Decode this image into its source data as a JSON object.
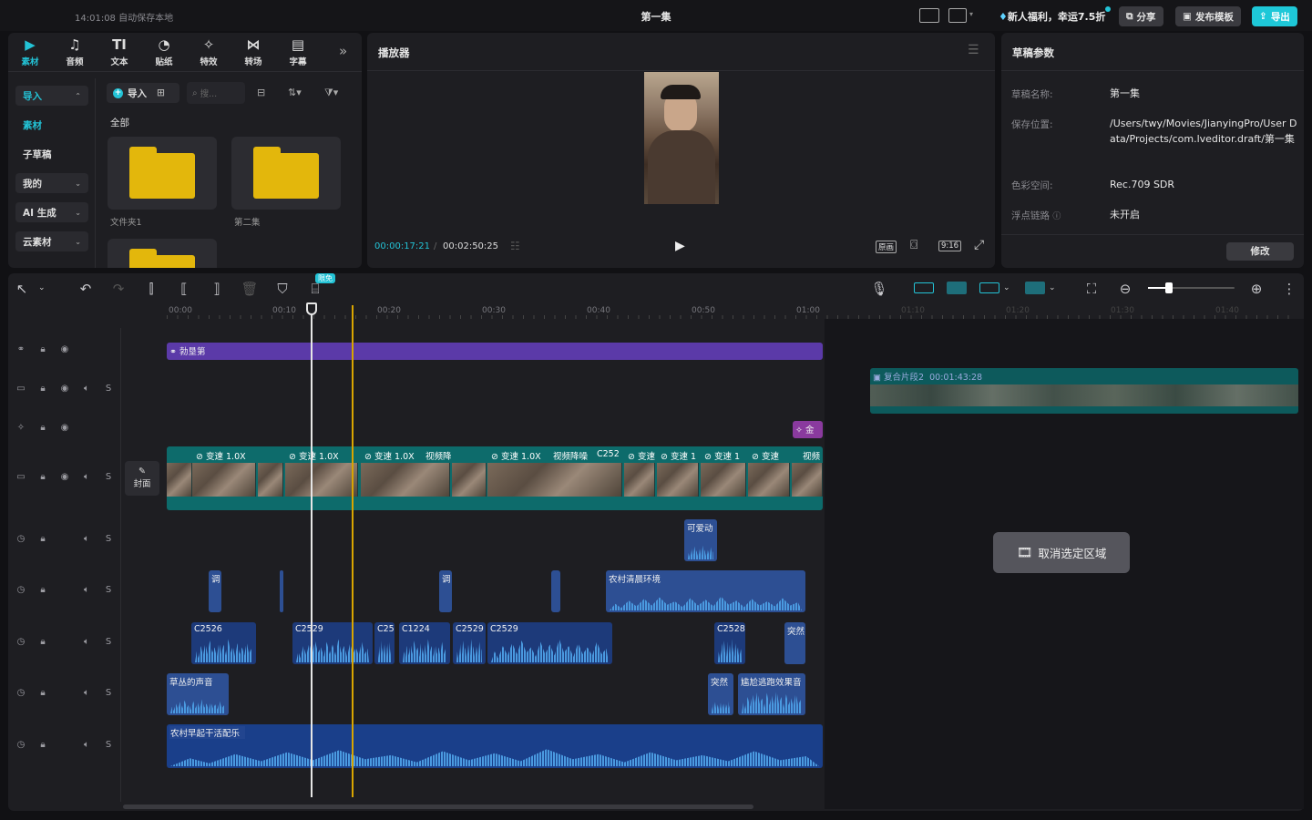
{
  "titlebar": {
    "autosave": "14:01:08 自动保存本地",
    "project_title": "第一集",
    "promo": "新人福利，幸运7.5折",
    "share": "分享",
    "publish_template": "发布模板",
    "export": "导出"
  },
  "media_panel": {
    "tabs": [
      {
        "icon": "▶",
        "label": "素材"
      },
      {
        "icon": "♫",
        "label": "音频"
      },
      {
        "icon": "TI",
        "label": "文本"
      },
      {
        "icon": "◔",
        "label": "贴纸"
      },
      {
        "icon": "✧",
        "label": "特效"
      },
      {
        "icon": "⋈",
        "label": "转场"
      },
      {
        "icon": "▤",
        "label": "字幕"
      }
    ],
    "sidebar": [
      "导入",
      "素材",
      "子草稿",
      "我的",
      "AI 生成",
      "云素材"
    ],
    "import_button": "导入",
    "search_placeholder": "搜...",
    "category": "全部",
    "folders": [
      "文件夹1",
      "第二集"
    ]
  },
  "player": {
    "title": "播放器",
    "current_time": "00:00:17:21",
    "total_time": "00:02:50:25",
    "original_btn": "原画",
    "ratio": "9:16"
  },
  "draft": {
    "title": "草稿参数",
    "name_label": "草稿名称:",
    "name": "第一集",
    "path_label": "保存位置:",
    "path": "/Users/twy/Movies/JianyingPro/User Data/Projects/com.lveditor.draft/第一集",
    "color_label": "色彩空间:",
    "color": "Rec.709 SDR",
    "float_label": "浮点链路",
    "float": "未开启",
    "modify": "修改"
  },
  "timeline": {
    "free_badge": "限免",
    "ruler": [
      "00:00",
      "00:10",
      "00:20",
      "00:30",
      "00:40",
      "00:50",
      "01:00",
      "01:10",
      "01:20",
      "01:30",
      "01:40"
    ],
    "cover": "封面",
    "filter_clip": "勃垦第",
    "compound": {
      "label": "复合片段2",
      "duration": "00:01:43:28"
    },
    "effect_clip": "金",
    "video_labels": [
      "变速 1.0X",
      "变速 1.0X",
      "变速 1.0X",
      "视频降",
      "变速 1.0X",
      "视频降噪",
      "C252",
      "变速",
      "变速 1",
      "变速 1",
      "变速",
      "视频"
    ],
    "audio_row1": [
      "可爱动"
    ],
    "audio_row2": [
      "调",
      "调",
      "农村清晨环境"
    ],
    "audio_row3": [
      "C2526",
      "C2529",
      "C25",
      "C1224",
      "C2529",
      "C2529",
      "C2528",
      "突然"
    ],
    "audio_row4": [
      "草丛的声音",
      "突然",
      "尴尬逃跑效果音"
    ],
    "music": "农村早起干活配乐",
    "deselect": "取消选定区域"
  }
}
